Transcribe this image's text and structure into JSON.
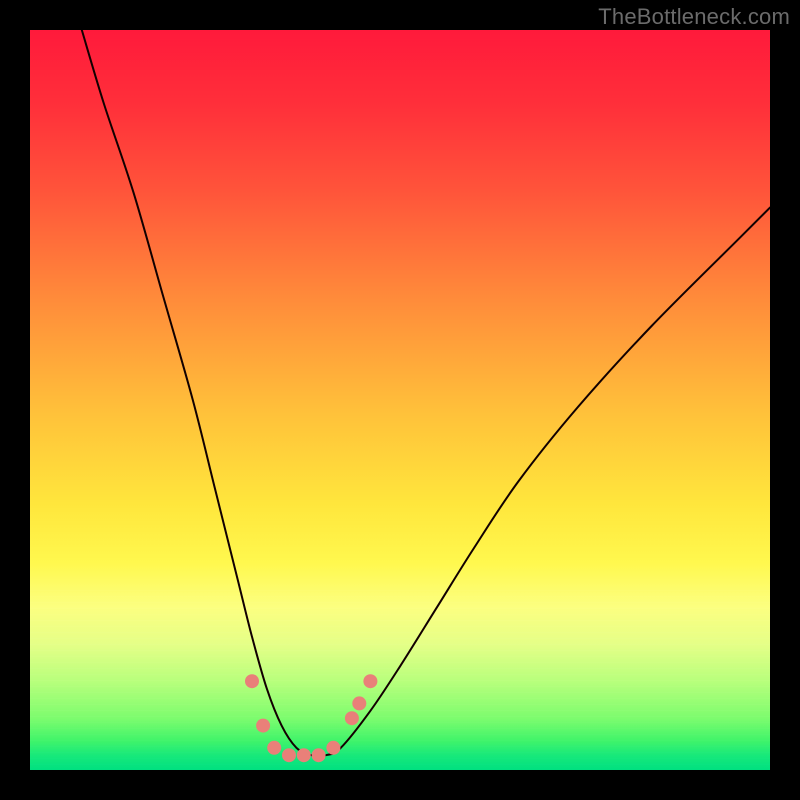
{
  "watermark": "TheBottleneck.com",
  "chart_data": {
    "type": "line",
    "title": "",
    "xlabel": "",
    "ylabel": "",
    "xlim": [
      0,
      100
    ],
    "ylim": [
      0,
      100
    ],
    "grid": false,
    "legend": false,
    "background_gradient": {
      "direction": "vertical",
      "stops": [
        {
          "pos": 0.0,
          "color": "#ff1a3b"
        },
        {
          "pos": 0.22,
          "color": "#ff553a"
        },
        {
          "pos": 0.52,
          "color": "#ffc23a"
        },
        {
          "pos": 0.72,
          "color": "#fff84e"
        },
        {
          "pos": 0.88,
          "color": "#b8ff7c"
        },
        {
          "pos": 1.0,
          "color": "#00e080"
        }
      ]
    },
    "series": [
      {
        "name": "bottleneck-curve",
        "color": "#120000",
        "stroke_width": 2,
        "x": [
          7,
          10,
          14,
          18,
          22,
          25,
          28,
          30,
          32,
          34,
          36,
          38,
          40,
          42,
          46,
          50,
          55,
          60,
          66,
          74,
          84,
          96,
          100
        ],
        "y": [
          100,
          90,
          78,
          64,
          50,
          38,
          26,
          18,
          11,
          6,
          3,
          2,
          2,
          3,
          8,
          14,
          22,
          30,
          39,
          49,
          60,
          72,
          76
        ]
      }
    ],
    "markers": {
      "name": "highlight-dots",
      "color": "#e98079",
      "radius": 7,
      "points": [
        {
          "x": 30,
          "y": 12
        },
        {
          "x": 31.5,
          "y": 6
        },
        {
          "x": 33,
          "y": 3
        },
        {
          "x": 35,
          "y": 2
        },
        {
          "x": 37,
          "y": 2
        },
        {
          "x": 39,
          "y": 2
        },
        {
          "x": 41,
          "y": 3
        },
        {
          "x": 43.5,
          "y": 7
        },
        {
          "x": 44.5,
          "y": 9
        },
        {
          "x": 46,
          "y": 12
        }
      ]
    }
  }
}
